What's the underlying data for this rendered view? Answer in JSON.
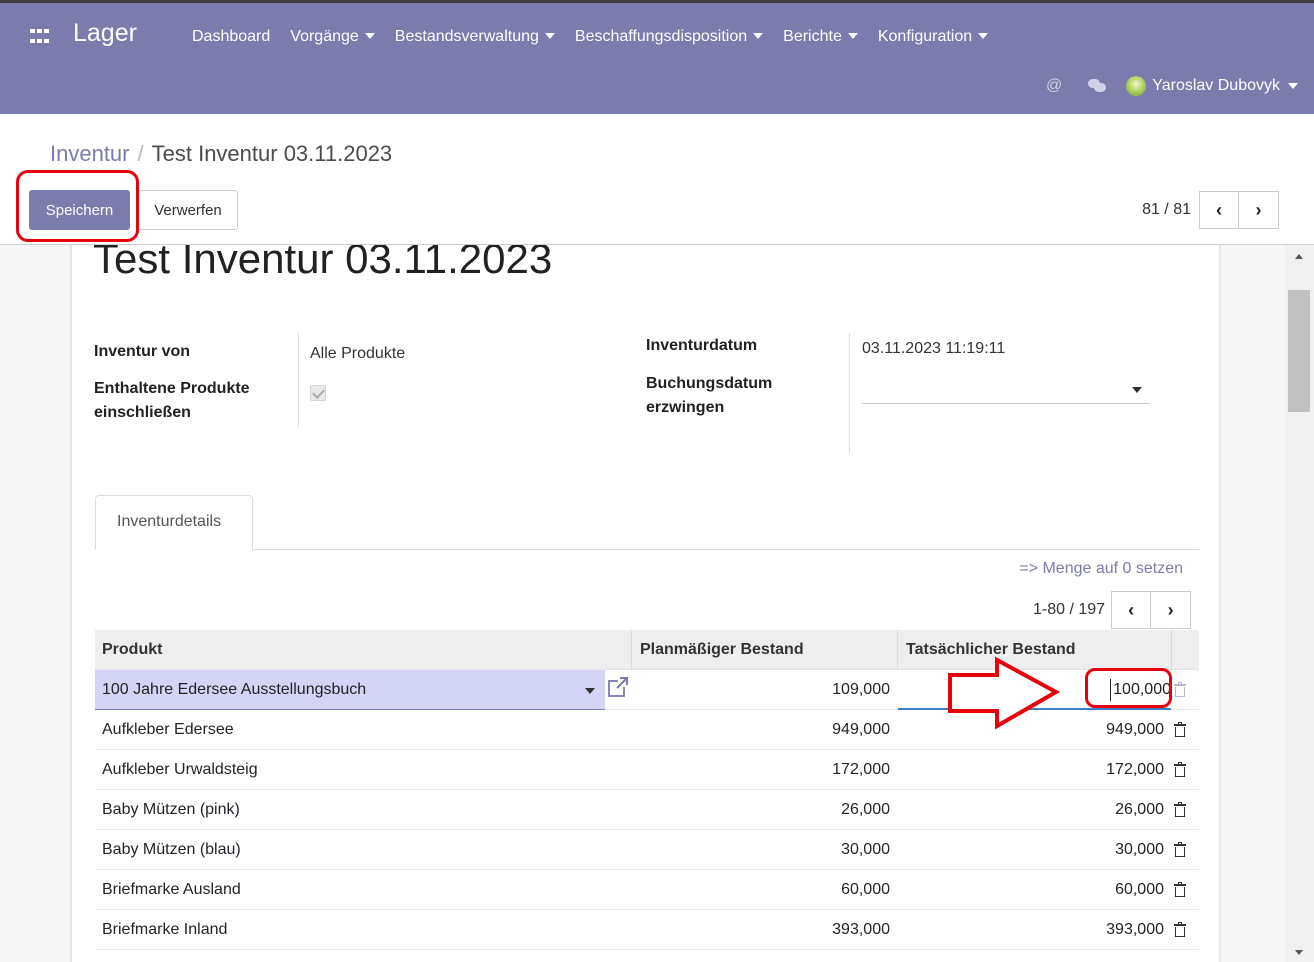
{
  "app": {
    "brand": "Lager",
    "menu": [
      {
        "label": "Dashboard",
        "dropdown": false
      },
      {
        "label": "Vorgänge",
        "dropdown": true
      },
      {
        "label": "Bestandsverwaltung",
        "dropdown": true
      },
      {
        "label": "Beschaffungsdisposition",
        "dropdown": true
      },
      {
        "label": "Berichte",
        "dropdown": true
      },
      {
        "label": "Konfiguration",
        "dropdown": true
      }
    ],
    "user_name": "Yaroslav Dubovyk",
    "at_symbol": "@"
  },
  "breadcrumb": {
    "parent": "Inventur",
    "separator": "/",
    "current": "Test Inventur 03.11.2023"
  },
  "buttons": {
    "save": "Speichern",
    "discard": "Verwerfen"
  },
  "pager": {
    "value": "81 / 81"
  },
  "form": {
    "title": "Test Inventur 03.11.2023",
    "inventory_of_label": "Inventur von",
    "inventory_of_value": "Alle Produkte",
    "include_products_label_1": "Enthaltene Produkte",
    "include_products_label_2": "einschließen",
    "include_products_checked": true,
    "inventory_date_label": "Inventurdatum",
    "inventory_date_value": "03.11.2023 11:19:11",
    "force_date_label_1": "Buchungsdatum",
    "force_date_label_2": "erzwingen",
    "force_date_value": ""
  },
  "tabs": {
    "details": "Inventurdetails"
  },
  "lines": {
    "reset_link": "=> Menge auf 0 setzen",
    "pager_value": "1-80 / 197",
    "headers": {
      "product": "Produkt",
      "planned": "Planmäßiger Bestand",
      "actual": "Tatsächlicher Bestand"
    },
    "edit_row": {
      "product": "100 Jahre Edersee  Ausstellungsbuch",
      "planned": "109,000",
      "actual": "100,000"
    },
    "rows": [
      {
        "product": "Aufkleber Edersee",
        "planned": "949,000",
        "actual": "949,000"
      },
      {
        "product": "Aufkleber Urwaldsteig",
        "planned": "172,000",
        "actual": "172,000"
      },
      {
        "product": "Baby Mützen (pink)",
        "planned": "26,000",
        "actual": "26,000"
      },
      {
        "product": "Baby Mützen (blau)",
        "planned": "30,000",
        "actual": "30,000"
      },
      {
        "product": "Briefmarke Ausland",
        "planned": "60,000",
        "actual": "60,000"
      },
      {
        "product": "Briefmarke Inland",
        "planned": "393,000",
        "actual": "393,000"
      }
    ]
  },
  "colors": {
    "primary": "#7c7bad",
    "highlight": "#e8000b",
    "edit_row_bg": "#d4d4f7"
  }
}
